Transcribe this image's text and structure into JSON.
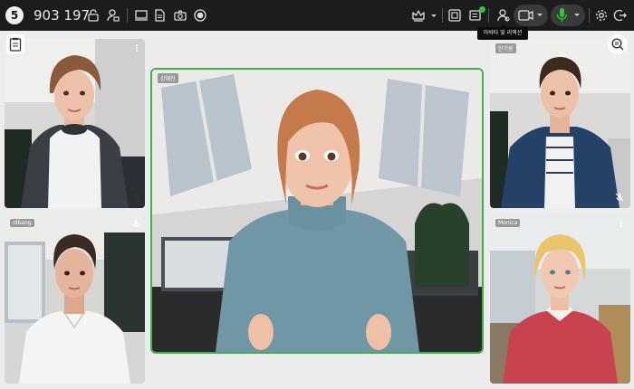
{
  "topbar": {
    "badge": "5",
    "meeting_id": "903 197",
    "tooltip": "아바타 및 리액션"
  },
  "participants": [
    {
      "name": ""
    },
    {
      "name": "강혜진"
    },
    {
      "name": "안기원"
    },
    {
      "name": "idbang"
    },
    {
      "name": "Monica"
    }
  ],
  "colors": {
    "topbar_bg": "#1c1c1c",
    "speaker_border": "#43b047",
    "notification_dot": "#35c23f",
    "mic_active": "#35c23f"
  }
}
